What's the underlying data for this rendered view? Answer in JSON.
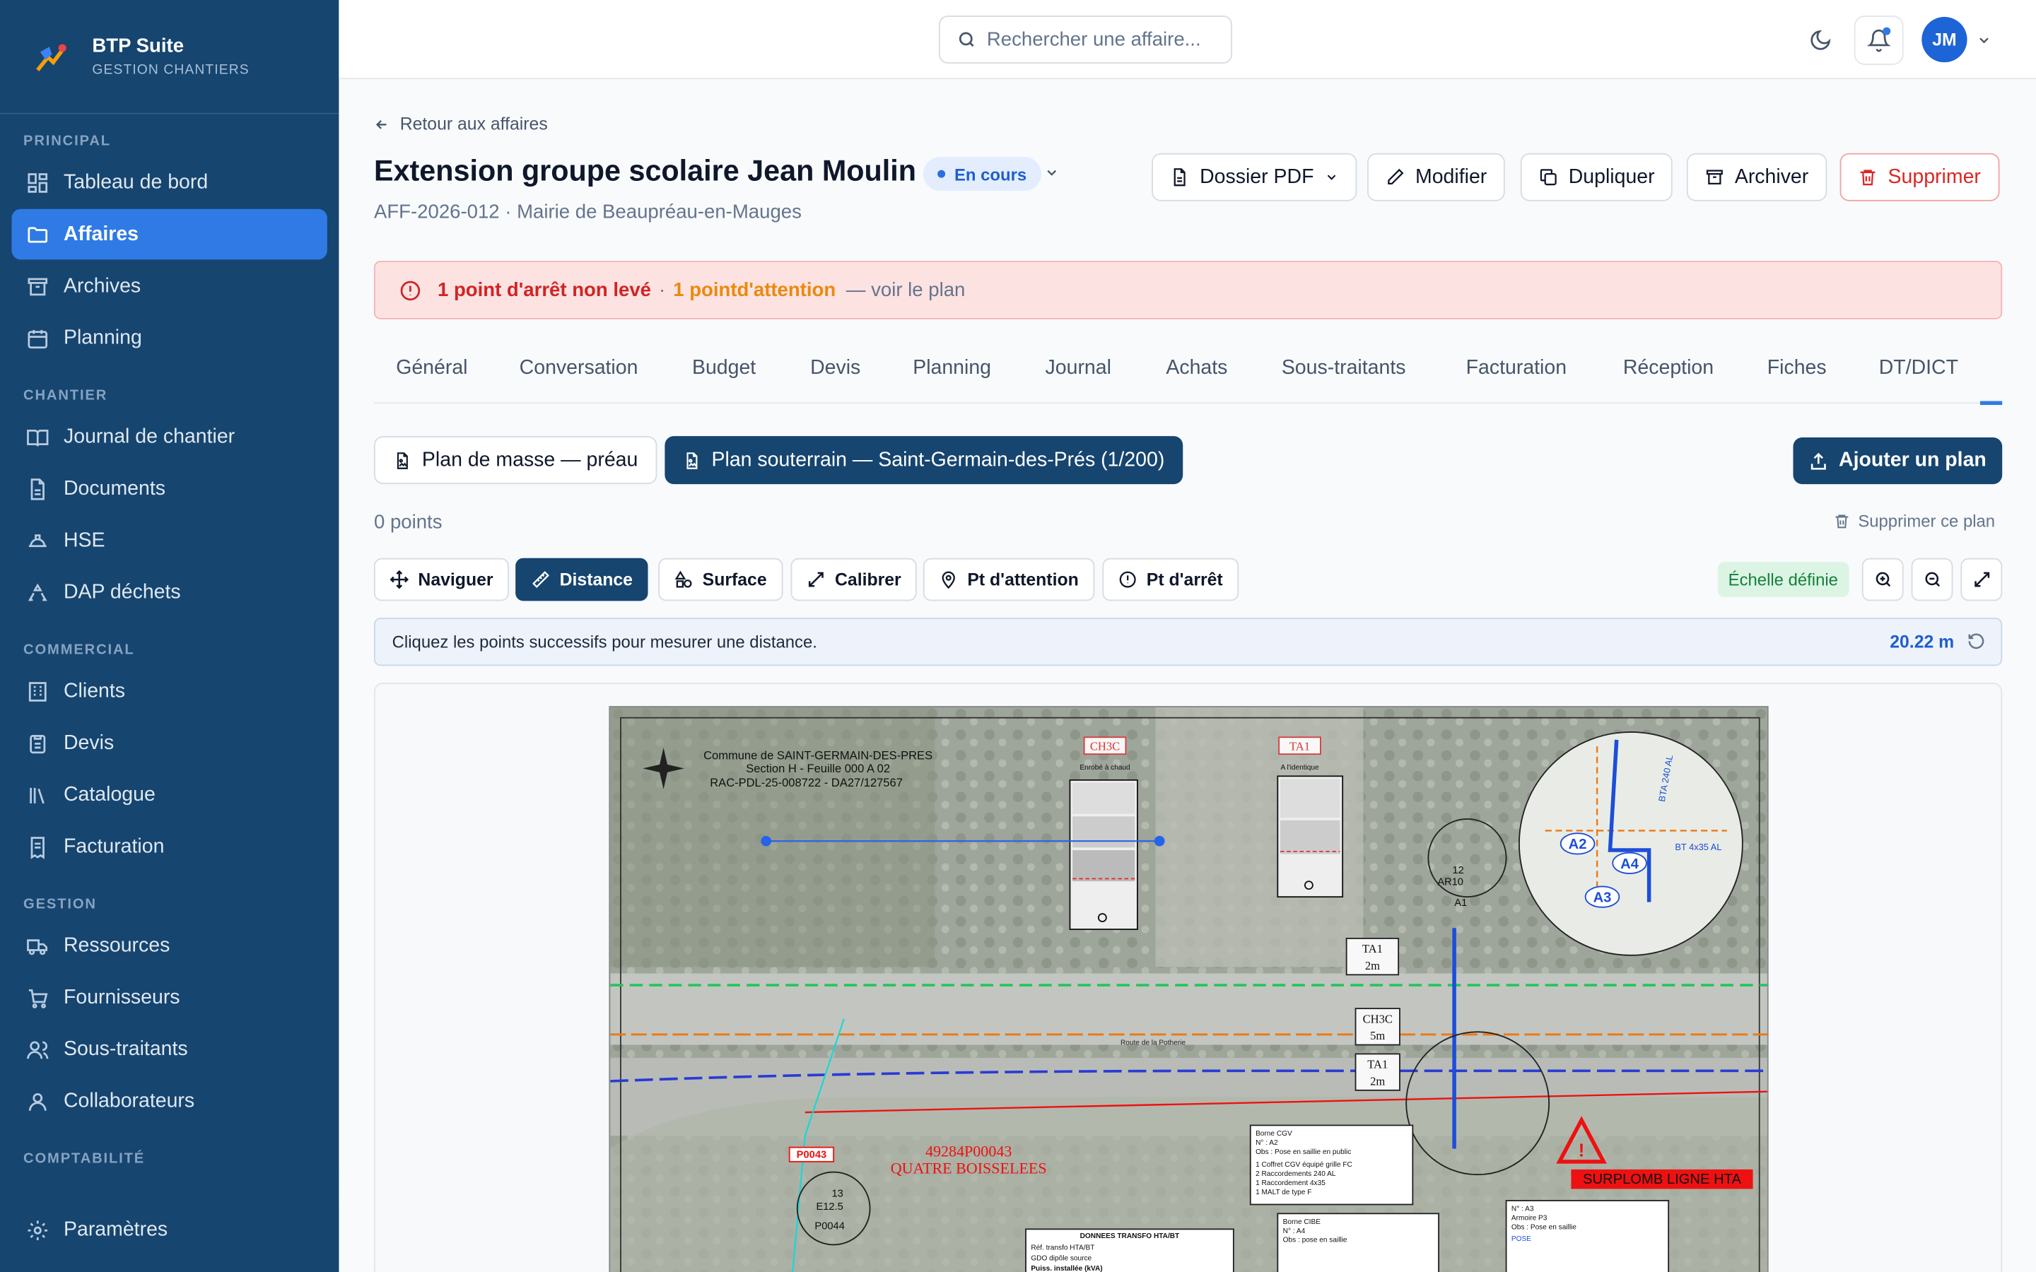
{
  "brand": {
    "name": "BTP Suite",
    "subtitle": "GESTION CHANTIERS"
  },
  "sidebar": {
    "sections": [
      {
        "label": "PRINCIPAL",
        "items": [
          {
            "label": "Tableau de bord",
            "icon": "dashboard-icon"
          },
          {
            "label": "Affaires",
            "icon": "folder-icon",
            "active": true
          },
          {
            "label": "Archives",
            "icon": "archive-icon"
          },
          {
            "label": "Planning",
            "icon": "calendar-icon"
          }
        ]
      },
      {
        "label": "CHANTIER",
        "items": [
          {
            "label": "Journal de chantier",
            "icon": "book-icon"
          },
          {
            "label": "Documents",
            "icon": "file-icon"
          },
          {
            "label": "HSE",
            "icon": "helmet-icon"
          },
          {
            "label": "DAP déchets",
            "icon": "recycle-icon"
          }
        ]
      },
      {
        "label": "COMMERCIAL",
        "items": [
          {
            "label": "Clients",
            "icon": "building-icon"
          },
          {
            "label": "Devis",
            "icon": "clipboard-icon"
          },
          {
            "label": "Catalogue",
            "icon": "library-icon"
          },
          {
            "label": "Facturation",
            "icon": "invoice-icon"
          }
        ]
      },
      {
        "label": "GESTION",
        "items": [
          {
            "label": "Ressources",
            "icon": "truck-icon"
          },
          {
            "label": "Fournisseurs",
            "icon": "cart-icon"
          },
          {
            "label": "Sous-traitants",
            "icon": "users-icon"
          },
          {
            "label": "Collaborateurs",
            "icon": "user-icon"
          }
        ]
      },
      {
        "label": "COMPTABILITÉ",
        "items": []
      }
    ],
    "footer": {
      "label": "Paramètres",
      "icon": "gear-icon"
    }
  },
  "topbar": {
    "search_placeholder": "Rechercher une affaire...",
    "avatar_initials": "JM"
  },
  "page": {
    "back_label": "Retour aux affaires",
    "title": "Extension groupe scolaire Jean Moulin",
    "status": "En cours",
    "subtitle": "AFF-2026-012 · Mairie de Beaupréau-en-Mauges",
    "actions": [
      "Dossier PDF",
      "Modifier",
      "Dupliquer",
      "Archiver",
      "Supprimer"
    ]
  },
  "alert": {
    "stop_points": "1 point d'arrêt non levé",
    "sep": "·",
    "attention": "1 pointd'attention",
    "link": "— voir le plan"
  },
  "tabs": [
    "Général",
    "Conversation",
    "Budget",
    "Devis",
    "Planning",
    "Journal",
    "Achats",
    "Sous-traitants",
    "Facturation",
    "Réception",
    "Fiches",
    "DT/DICT"
  ],
  "plans": {
    "items": [
      "Plan de masse — préau",
      "Plan souterrain — Saint-Germain-des-Prés (1/200)"
    ],
    "active_index": 1,
    "add_label": "Ajouter un plan",
    "points_count": "0 points",
    "delete_label": "Supprimer ce plan"
  },
  "tools": {
    "items": [
      "Naviguer",
      "Distance",
      "Surface",
      "Calibrer",
      "Pt d'attention",
      "Pt d'arrêt"
    ],
    "active": "Distance",
    "scale_status": "Échelle définie"
  },
  "measure": {
    "instruction": "Cliquez les points successifs pour mesurer une distance.",
    "distance": "20.22 m"
  },
  "drawing": {
    "header": [
      "Commune de SAINT-GERMAIN-DES-PRES",
      "Section H - Feuille 000 A 02",
      "RAC-PDL-25-008722 - DA27/127567"
    ],
    "ch3c_label": "CH3C",
    "ta1_label": "TA1",
    "enrobe": "Enrobé à chaud",
    "ta1_sub": "A l'identique",
    "ta1_2m": [
      "TA1",
      "2m"
    ],
    "ch3c_5m": [
      "CH3C",
      "5m"
    ],
    "ta1_2m_b": [
      "TA1",
      "2m"
    ],
    "ar10": [
      "12",
      "AR10"
    ],
    "a1": "A1",
    "road": "Route de la Potherie",
    "parcel": [
      "49284P00043",
      "QUATRE BOISSELEES"
    ],
    "p0043": "P0043",
    "p0044": [
      "13",
      "E12.5",
      "P0044"
    ],
    "warning": "SURPLOMB LIGNE HTA",
    "borne1": [
      "Borne CGV",
      "N° : A2",
      "Obs : Pose en saillie en public",
      "1 Coffret CGV équipé grille FC",
      "2 Raccordements 240 AL",
      "1 Raccordement 4x35",
      "1 MALT de type F"
    ],
    "borne2": [
      "Borne CIBE",
      "N° : A4",
      "Obs : pose en saillie"
    ],
    "borne3": [
      "N° : A3",
      "Armoire P3",
      "Obs : Pose en saillie",
      "POSE"
    ],
    "transfo": [
      "DONNEES TRANSFO HTA/BT",
      "Réf. transfo HTA/BT",
      "GDO dipôle source",
      "Puiss. installée (kVA)"
    ],
    "detail_labels": [
      "A2",
      "A4",
      "A3",
      "BTA 240 AL",
      "BT 4x35 AL"
    ]
  },
  "colors": {
    "sidebar": "#16456f",
    "accent": "#2f7ae5",
    "danger": "#dc2626",
    "warning": "#ea8a0c",
    "success": "#15803d"
  }
}
